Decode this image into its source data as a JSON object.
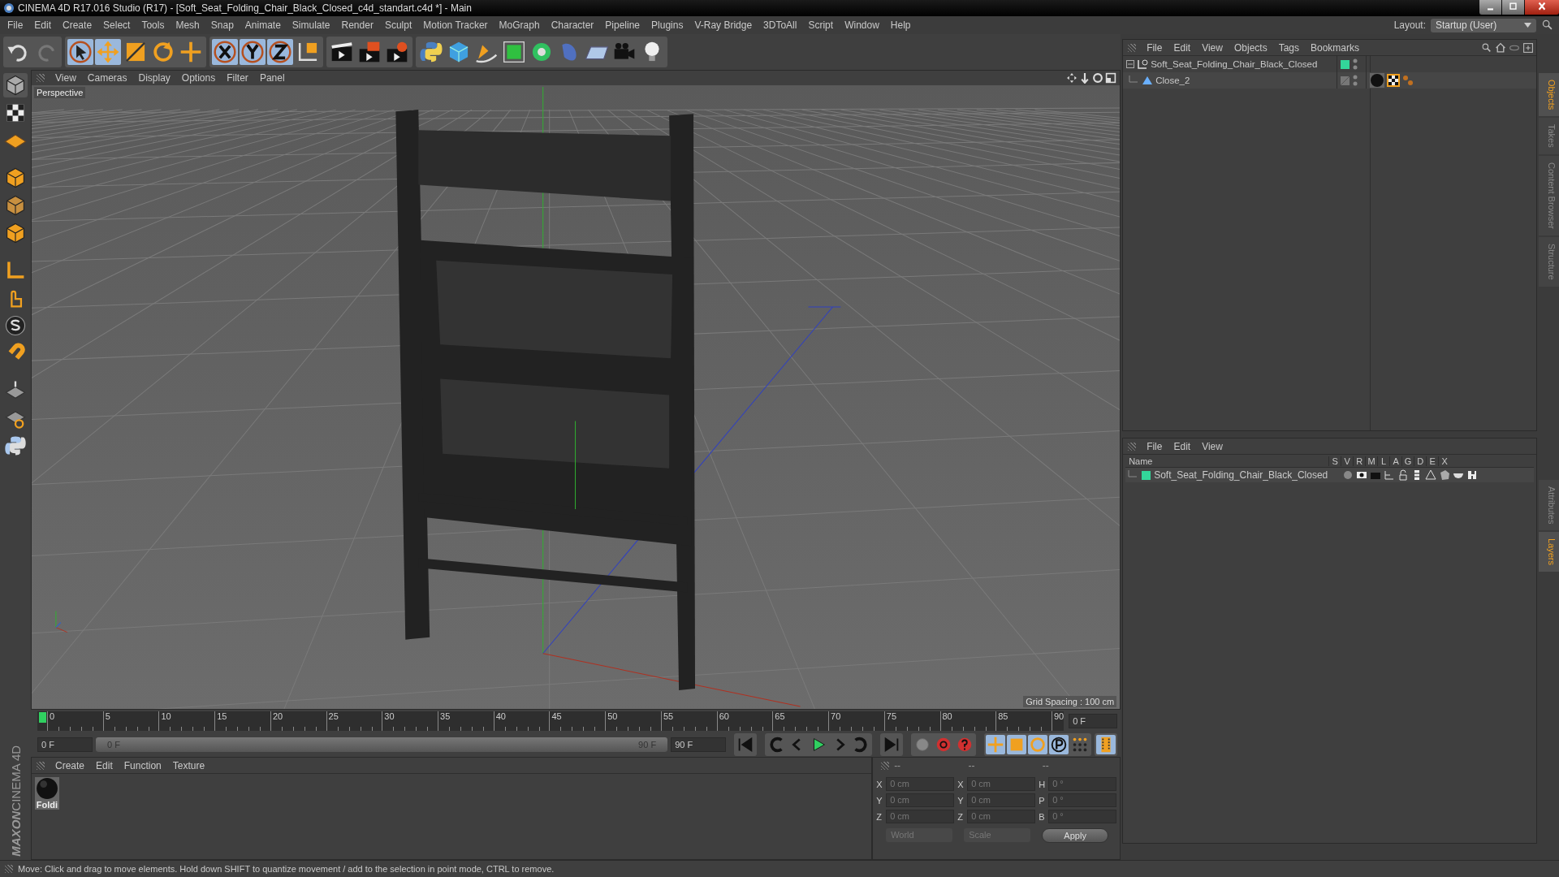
{
  "window": {
    "title": "CINEMA 4D R17.016 Studio (R17) - [Soft_Seat_Folding_Chair_Black_Closed_c4d_standart.c4d *] - Main"
  },
  "menu": [
    "File",
    "Edit",
    "Create",
    "Select",
    "Tools",
    "Mesh",
    "Snap",
    "Animate",
    "Simulate",
    "Render",
    "Sculpt",
    "Motion Tracker",
    "MoGraph",
    "Character",
    "Pipeline",
    "Plugins",
    "V-Ray Bridge",
    "3DToAll",
    "Script",
    "Window",
    "Help"
  ],
  "layout": {
    "label": "Layout:",
    "value": "Startup (User)"
  },
  "viewport": {
    "menu": [
      "View",
      "Cameras",
      "Display",
      "Options",
      "Filter",
      "Panel"
    ],
    "camera": "Perspective",
    "grid_spacing": "Grid Spacing : 100 cm"
  },
  "logo": [
    "MAXON",
    "CINEMA 4D"
  ],
  "timeline": {
    "ticks": [
      "0",
      "5",
      "10",
      "15",
      "20",
      "25",
      "30",
      "35",
      "40",
      "45",
      "50",
      "55",
      "60",
      "65",
      "70",
      "75",
      "80",
      "85",
      "90"
    ],
    "current_frame": "0 F",
    "start": "0 F",
    "range": {
      "start": "0 F",
      "end": "90 F",
      "level": 1
    },
    "end": "90 F"
  },
  "materials": {
    "menu": [
      "Create",
      "Edit",
      "Function",
      "Texture"
    ],
    "items": [
      {
        "name": "Foldi"
      }
    ]
  },
  "coordinates": {
    "headers": [
      "--",
      "--",
      "--"
    ],
    "columns": [
      {
        "rows": [
          {
            "axis": "X",
            "value": "0 cm"
          },
          {
            "axis": "Y",
            "value": "0 cm"
          },
          {
            "axis": "Z",
            "value": "0 cm"
          }
        ]
      },
      {
        "rows": [
          {
            "axis": "X",
            "value": "0 cm"
          },
          {
            "axis": "Y",
            "value": "0 cm"
          },
          {
            "axis": "Z",
            "value": "0 cm"
          }
        ]
      },
      {
        "rows": [
          {
            "axis": "H",
            "value": "0 °"
          },
          {
            "axis": "P",
            "value": "0 °"
          },
          {
            "axis": "B",
            "value": "0 °"
          }
        ]
      }
    ],
    "space": "World",
    "mode": "Scale",
    "apply": "Apply"
  },
  "status_bar": "Move: Click and drag to move elements. Hold down SHIFT to quantize movement / add to the selection in point mode, CTRL to remove.",
  "objects": {
    "menu": [
      "File",
      "Edit",
      "View",
      "Objects",
      "Tags",
      "Bookmarks"
    ],
    "tree": [
      {
        "name": "Soft_Seat_Folding_Chair_Black_Closed",
        "expanded": true,
        "color": "#33d69a",
        "children": [
          {
            "name": "Close_2"
          }
        ]
      }
    ]
  },
  "layers": {
    "menu": [
      "File",
      "Edit",
      "View"
    ],
    "columns": [
      "Name",
      "S",
      "V",
      "R",
      "M",
      "L",
      "A",
      "G",
      "D",
      "E",
      "X"
    ],
    "rows": [
      {
        "name": "Soft_Seat_Folding_Chair_Black_Closed",
        "color": "#33d69a"
      }
    ]
  },
  "side_tabs": [
    {
      "label": "Objects",
      "selected": true
    },
    {
      "label": "Takes",
      "selected": false
    },
    {
      "label": "Content Browser",
      "selected": false
    },
    {
      "label": "Structure",
      "selected": false
    },
    {
      "label": "Attributes",
      "selected": false
    },
    {
      "label": "Layers",
      "selected": true
    }
  ]
}
